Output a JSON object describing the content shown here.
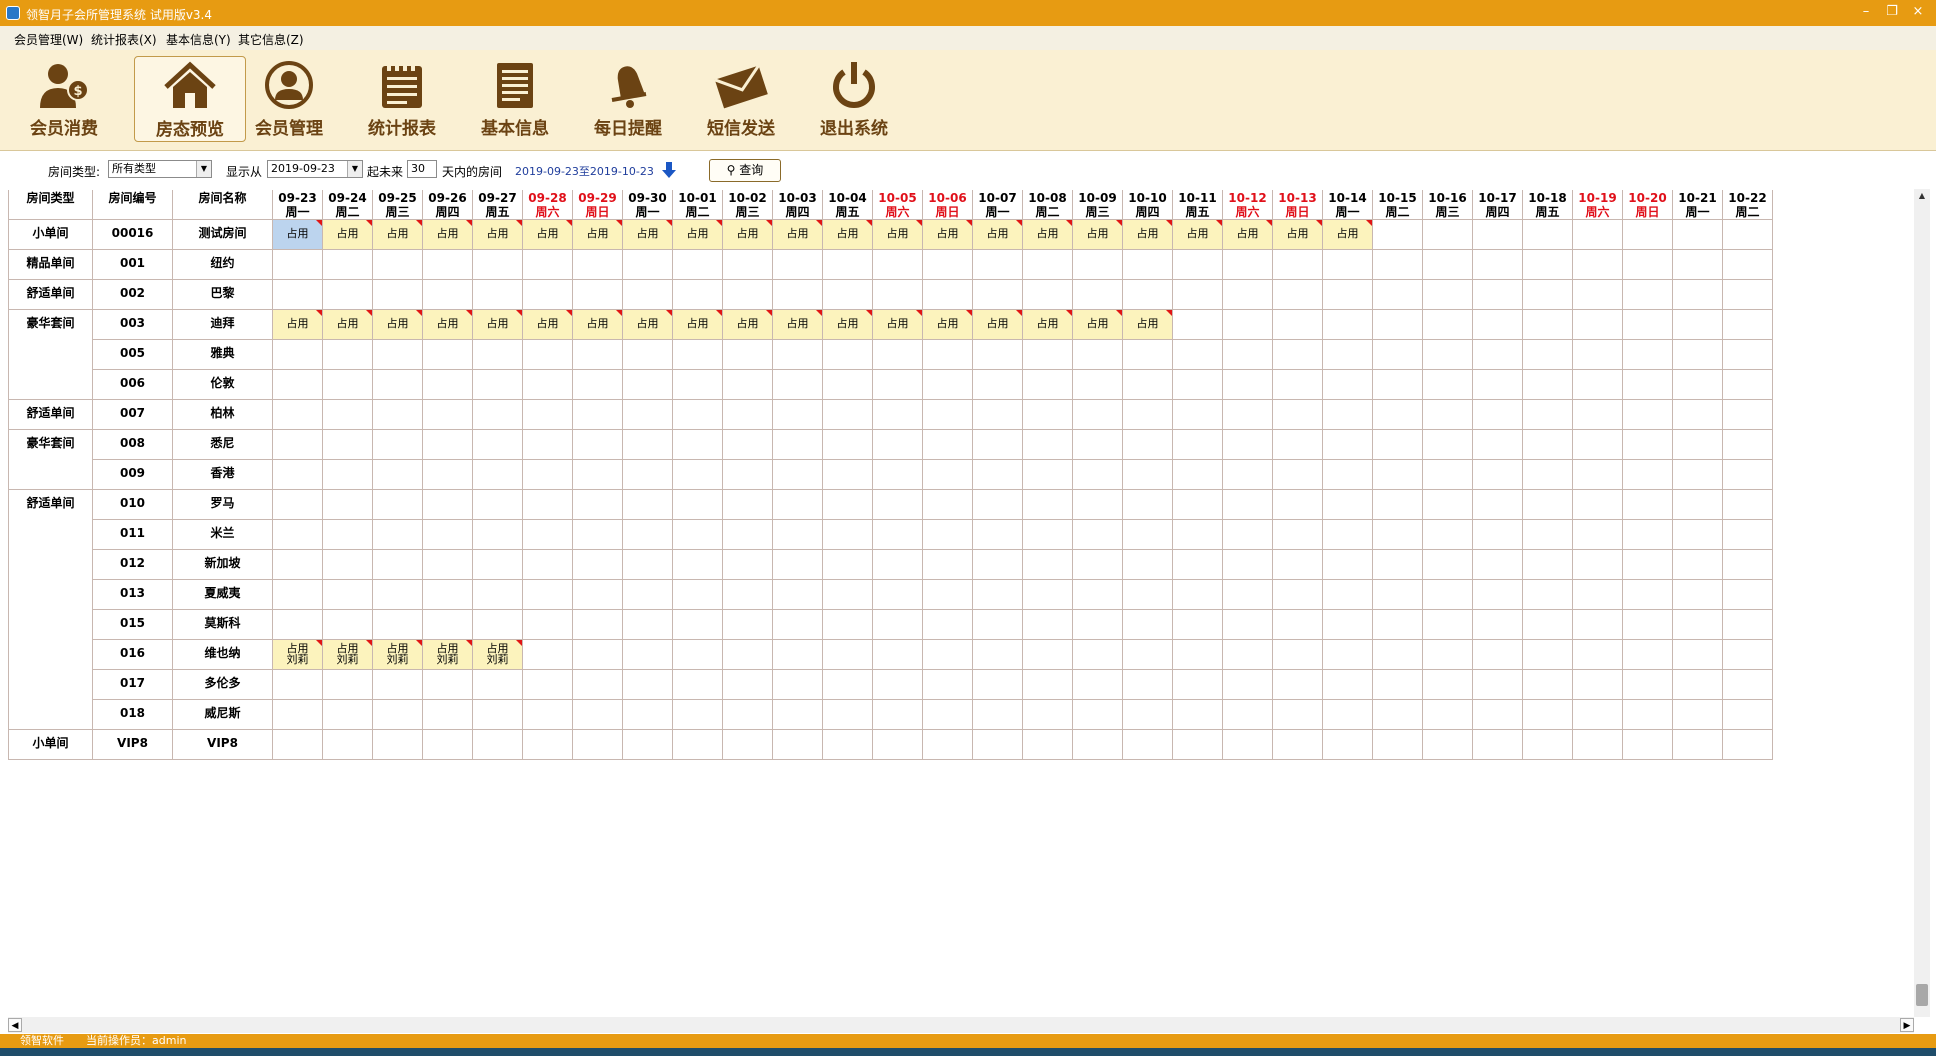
{
  "window": {
    "title": "领智月子会所管理系统 试用版v3.4",
    "minimize": "–",
    "maximize": "❐",
    "close": "×"
  },
  "menu": [
    "会员管理(W)",
    "统计报表(X)",
    "基本信息(Y)",
    "其它信息(Z)"
  ],
  "toolbar": [
    {
      "label": "会员消费",
      "icon": "member-consume-icon"
    },
    {
      "label": "房态预览",
      "icon": "house-icon",
      "active": true
    },
    {
      "label": "会员管理",
      "icon": "person-icon"
    },
    {
      "label": "统计报表",
      "icon": "notepad-icon"
    },
    {
      "label": "基本信息",
      "icon": "document-icon"
    },
    {
      "label": "每日提醒",
      "icon": "bell-icon"
    },
    {
      "label": "短信发送",
      "icon": "envelope-icon"
    },
    {
      "label": "退出系统",
      "icon": "power-icon"
    }
  ],
  "filter": {
    "room_type_label": "房间类型:",
    "room_type_value": "所有类型",
    "show_from_label": "显示从",
    "date_value": "2019-09-23",
    "future_label": "起未来",
    "days_value": "30",
    "days_suffix": "天内的房间",
    "range_text": "2019-09-23至2019-10-23",
    "query_button": "查询"
  },
  "grid": {
    "headers": {
      "type": "房间类型",
      "code": "房间编号",
      "name": "房间名称"
    },
    "dates": [
      {
        "d": "09-23",
        "w": "周一"
      },
      {
        "d": "09-24",
        "w": "周二"
      },
      {
        "d": "09-25",
        "w": "周三"
      },
      {
        "d": "09-26",
        "w": "周四"
      },
      {
        "d": "09-27",
        "w": "周五"
      },
      {
        "d": "09-28",
        "w": "周六",
        "weekend": true
      },
      {
        "d": "09-29",
        "w": "周日",
        "weekend": true
      },
      {
        "d": "09-30",
        "w": "周一"
      },
      {
        "d": "10-01",
        "w": "周二"
      },
      {
        "d": "10-02",
        "w": "周三"
      },
      {
        "d": "10-03",
        "w": "周四"
      },
      {
        "d": "10-04",
        "w": "周五"
      },
      {
        "d": "10-05",
        "w": "周六",
        "weekend": true
      },
      {
        "d": "10-06",
        "w": "周日",
        "weekend": true
      },
      {
        "d": "10-07",
        "w": "周一"
      },
      {
        "d": "10-08",
        "w": "周二"
      },
      {
        "d": "10-09",
        "w": "周三"
      },
      {
        "d": "10-10",
        "w": "周四"
      },
      {
        "d": "10-11",
        "w": "周五"
      },
      {
        "d": "10-12",
        "w": "周六",
        "weekend": true
      },
      {
        "d": "10-13",
        "w": "周日",
        "weekend": true
      },
      {
        "d": "10-14",
        "w": "周一"
      },
      {
        "d": "10-15",
        "w": "周二"
      },
      {
        "d": "10-16",
        "w": "周三"
      },
      {
        "d": "10-17",
        "w": "周四"
      },
      {
        "d": "10-18",
        "w": "周五"
      },
      {
        "d": "10-19",
        "w": "周六",
        "weekend": true
      },
      {
        "d": "10-20",
        "w": "周日",
        "weekend": true
      },
      {
        "d": "10-21",
        "w": "周一"
      },
      {
        "d": "10-22",
        "w": "周二"
      }
    ],
    "occupied_label": "占用",
    "rows": [
      {
        "type": "小单间",
        "code": "00016",
        "name": "测试房间",
        "occupied": 22,
        "guest": "",
        "selected_first": true
      },
      {
        "type": "精品单间",
        "code": "001",
        "name": "纽约",
        "occupied": 0,
        "guest": ""
      },
      {
        "type": "舒适单间",
        "code": "002",
        "name": "巴黎",
        "occupied": 0,
        "guest": ""
      },
      {
        "type": "豪华套间",
        "code": "003",
        "name": "迪拜",
        "occupied": 18,
        "guest": ""
      },
      {
        "type": "",
        "code": "005",
        "name": "雅典",
        "occupied": 0,
        "guest": ""
      },
      {
        "type": "",
        "code": "006",
        "name": "伦敦",
        "occupied": 0,
        "guest": ""
      },
      {
        "type": "舒适单间",
        "code": "007",
        "name": "柏林",
        "occupied": 0,
        "guest": ""
      },
      {
        "type": "豪华套间",
        "code": "008",
        "name": "悉尼",
        "occupied": 0,
        "guest": ""
      },
      {
        "type": "",
        "code": "009",
        "name": "香港",
        "occupied": 0,
        "guest": ""
      },
      {
        "type": "舒适单间",
        "code": "010",
        "name": "罗马",
        "occupied": 0,
        "guest": ""
      },
      {
        "type": "",
        "code": "011",
        "name": "米兰",
        "occupied": 0,
        "guest": ""
      },
      {
        "type": "",
        "code": "012",
        "name": "新加坡",
        "occupied": 0,
        "guest": ""
      },
      {
        "type": "",
        "code": "013",
        "name": "夏威夷",
        "occupied": 0,
        "guest": ""
      },
      {
        "type": "",
        "code": "015",
        "name": "莫斯科",
        "occupied": 0,
        "guest": ""
      },
      {
        "type": "",
        "code": "016",
        "name": "维也纳",
        "occupied": 5,
        "guest": "刘莉"
      },
      {
        "type": "",
        "code": "017",
        "name": "多伦多",
        "occupied": 0,
        "guest": ""
      },
      {
        "type": "",
        "code": "018",
        "name": "威尼斯",
        "occupied": 0,
        "guest": ""
      },
      {
        "type": "小单间",
        "code": "VIP8",
        "name": "VIP8",
        "occupied": 0,
        "guest": ""
      }
    ]
  },
  "status": {
    "company": "领智软件",
    "operator": "当前操作员：admin"
  },
  "colors": {
    "titlebar": "#e79b12",
    "toolbar_bg": "#faf0d3",
    "occupied": "#fcf3bd",
    "weekend": "#e0101a",
    "icon_brown": "#6b4313"
  }
}
